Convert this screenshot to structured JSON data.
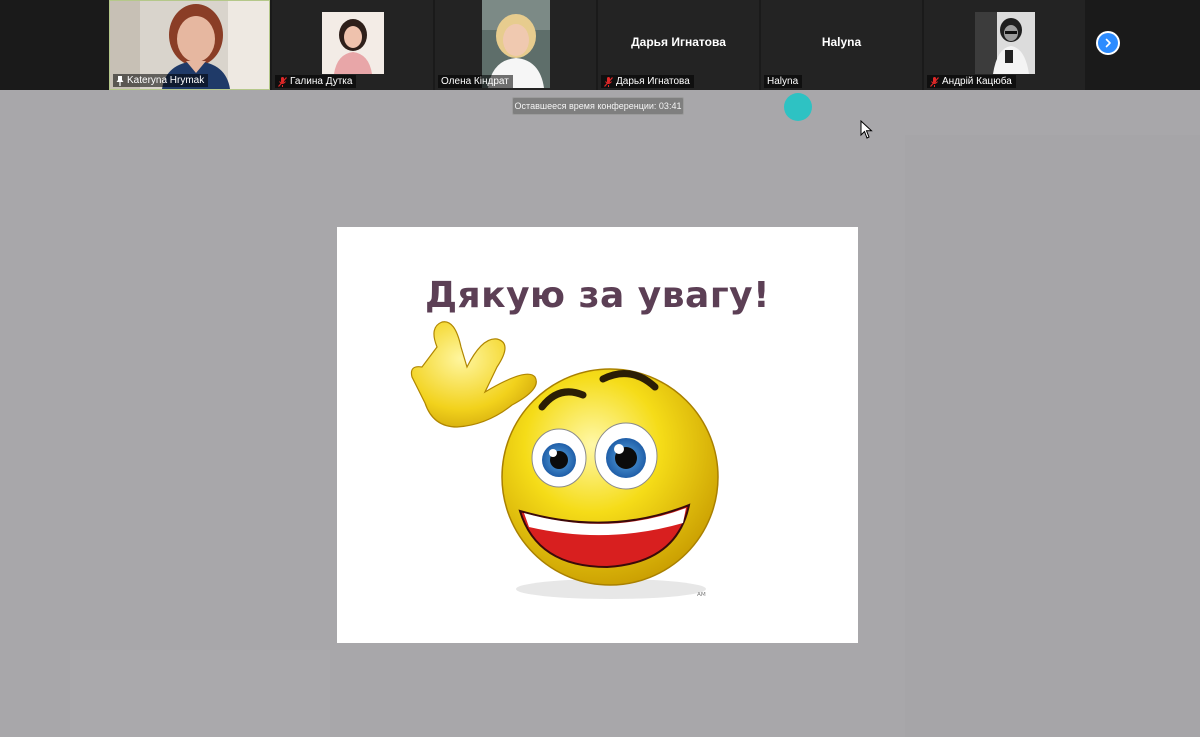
{
  "participants": [
    {
      "name": "Kateryna Hrymak",
      "muted": false,
      "pinned": true,
      "video": true
    },
    {
      "name": "Галина Дутка",
      "muted": true,
      "pinned": false,
      "video": true
    },
    {
      "name": "Олена Кіндрат",
      "muted": false,
      "pinned": false,
      "video": true
    },
    {
      "name": "Дарья Игнатова",
      "display_name": "Дарья Игнатова",
      "muted": true,
      "pinned": false,
      "video": false
    },
    {
      "name": "Halyna",
      "display_name": "Halyna",
      "muted": false,
      "pinned": false,
      "video": false
    },
    {
      "name": "Андрій Кацюба",
      "muted": true,
      "pinned": false,
      "video": true
    }
  ],
  "timer": {
    "label": "Оставшееся время конференции: 03:41"
  },
  "slide": {
    "title": "Дякую за увагу!",
    "signature": "ᴬᴹ"
  },
  "colors": {
    "accent": "#2d8cff",
    "pointer": "#27c3c4",
    "mute": "#e02828",
    "active_border": "#b5c88a"
  },
  "icons": {
    "next": "chevron-right-icon",
    "mute": "mic-off-icon",
    "pin": "pin-icon",
    "cursor": "mouse-cursor-icon"
  }
}
